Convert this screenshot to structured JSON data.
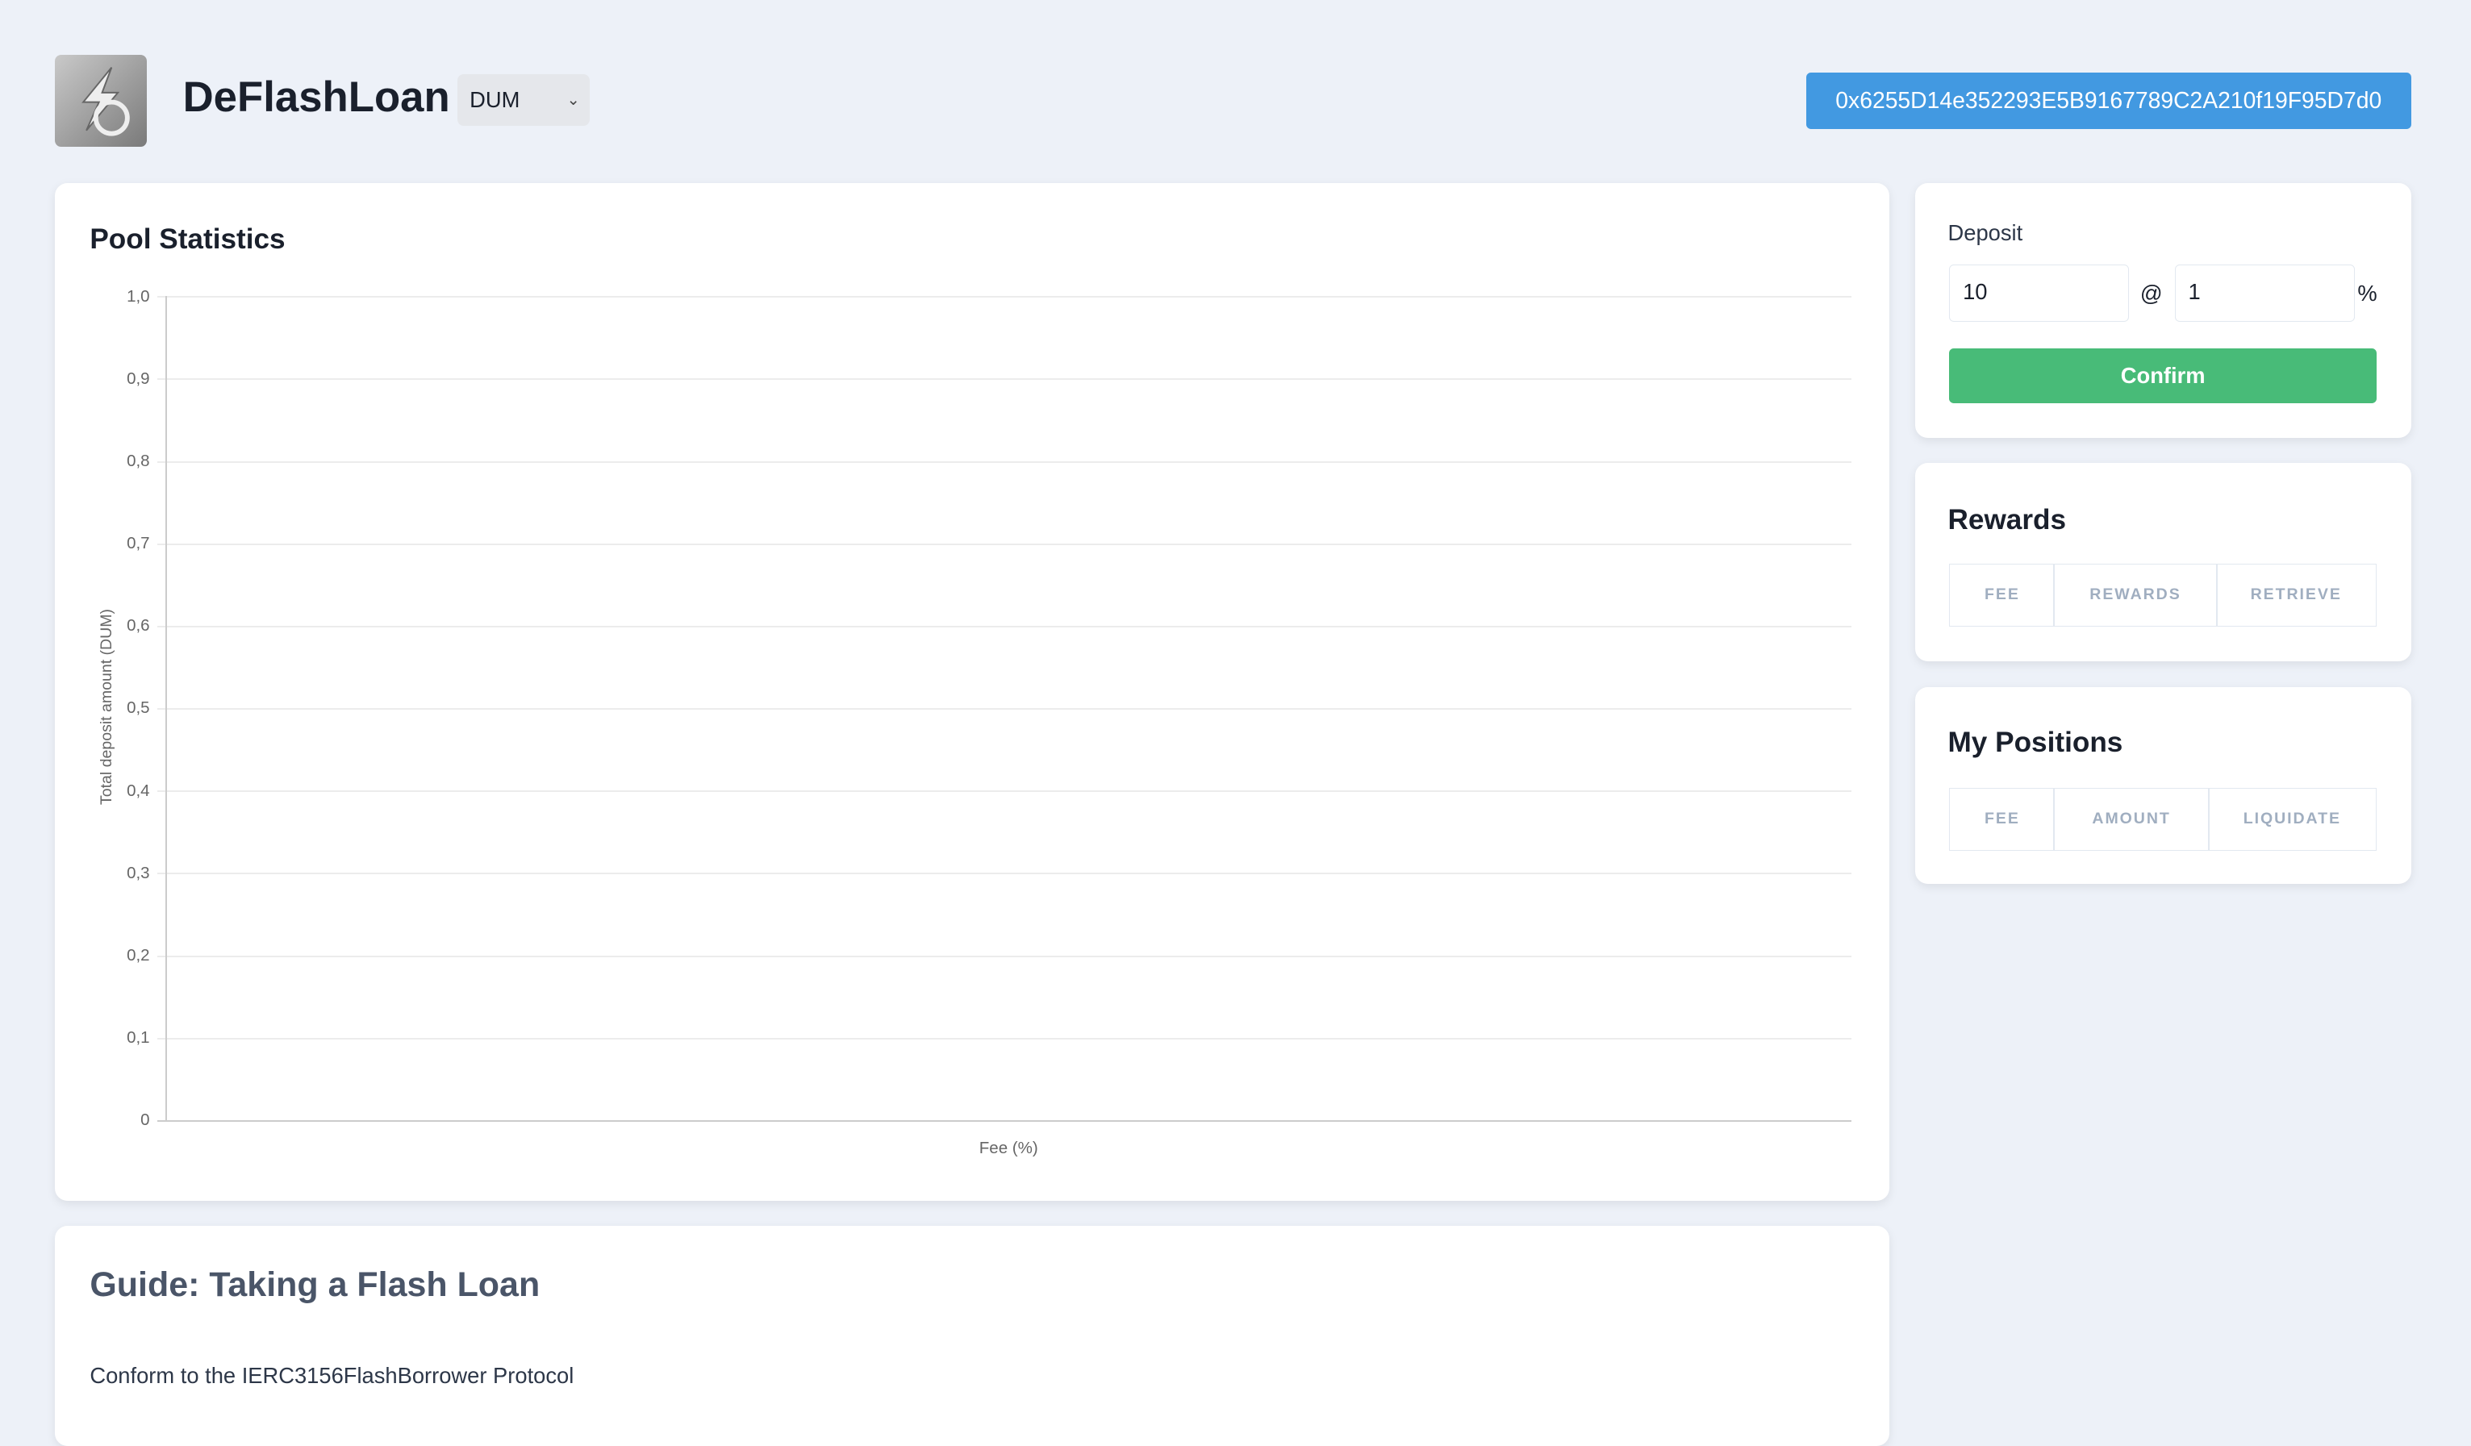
{
  "header": {
    "title": "DeFlashLoan",
    "token_select": "DUM",
    "address": "0x6255D14e352293E5B9167789C2A210f19F95D7d0"
  },
  "pool": {
    "title": "Pool Statistics"
  },
  "chart_data": {
    "type": "bar",
    "title": "",
    "xlabel": "Fee (%)",
    "ylabel": "Total deposit amount (DUM)",
    "ylim": [
      0,
      1
    ],
    "yticks": [
      "0",
      "0,1",
      "0,2",
      "0,3",
      "0,4",
      "0,5",
      "0,6",
      "0,7",
      "0,8",
      "0,9",
      "1,0"
    ],
    "categories": [],
    "values": [],
    "grid": true
  },
  "deposit": {
    "label": "Deposit",
    "amount": "10",
    "at": "@",
    "fee": "1",
    "percent": "%",
    "confirm": "Confirm"
  },
  "rewards": {
    "title": "Rewards",
    "columns": [
      "FEE",
      "REWARDS",
      "RETRIEVE"
    ]
  },
  "positions": {
    "title": "My Positions",
    "columns": [
      "FEE",
      "AMOUNT",
      "LIQUIDATE"
    ]
  },
  "guide": {
    "title": "Guide: Taking a Flash Loan",
    "text": "Conform to the IERC3156FlashBorrower Protocol"
  },
  "colors": {
    "accent": "#4299e1",
    "confirm": "#48bb78"
  }
}
